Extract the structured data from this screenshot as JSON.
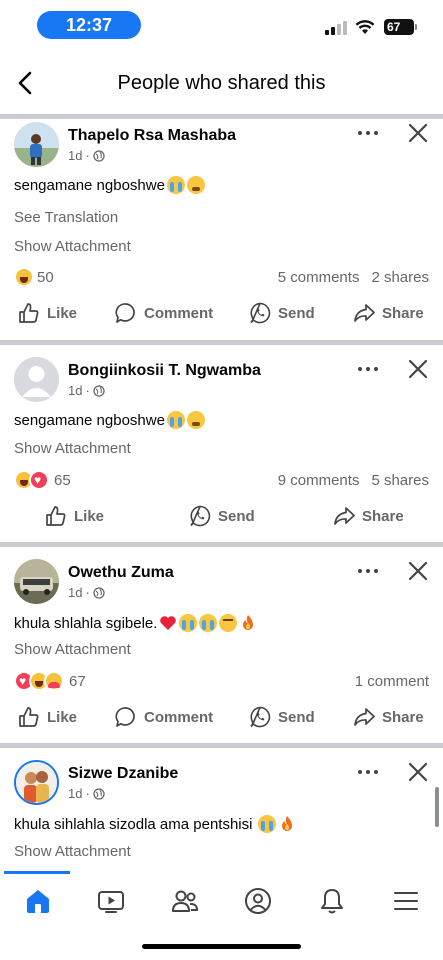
{
  "status_bar": {
    "time": "12:37",
    "battery": "67"
  },
  "header": {
    "title": "People who shared this"
  },
  "posts": [
    {
      "author": "Thapelo Rsa Mashaba",
      "time": "1d",
      "text": "sengamane ngboshwe",
      "emojis": [
        "loudly-crying-face",
        "face-with-steam"
      ],
      "see_translation": "See Translation",
      "show_attachment": "Show Attachment",
      "reaction_icons": [
        "haha"
      ],
      "reaction_count": "50",
      "comments": "5 comments",
      "shares": "2 shares",
      "actions": [
        "Like",
        "Comment",
        "Send",
        "Share"
      ]
    },
    {
      "author": "Bongiinkosii T. Ngwamba",
      "time": "1d",
      "text": "sengamane ngboshwe",
      "emojis": [
        "loudly-crying-face",
        "face-with-steam"
      ],
      "show_attachment": "Show Attachment",
      "reaction_icons": [
        "haha",
        "love"
      ],
      "reaction_count": "65",
      "comments": "9 comments",
      "shares": "5 shares",
      "actions": [
        "Like",
        "Send",
        "Share"
      ]
    },
    {
      "author": "Owethu Zuma",
      "time": "1d",
      "text": "khula shlahla sgibele.",
      "emojis": [
        "red-heart",
        "loudly-crying-face",
        "loudly-crying-face",
        "unamused-face",
        "fire"
      ],
      "show_attachment": "Show Attachment",
      "reaction_icons": [
        "love",
        "haha",
        "care"
      ],
      "reaction_count": "67",
      "comments": "1 comment",
      "actions": [
        "Like",
        "Comment",
        "Send",
        "Share"
      ]
    },
    {
      "author": "Sizwe Dzanibe",
      "time": "1d",
      "text": "khula sihlahla sizodla ama pentshisi",
      "emojis": [
        "loudly-crying-face",
        "fire"
      ],
      "show_attachment": "Show Attachment"
    }
  ],
  "bottom_nav": {
    "items": [
      "home-icon",
      "video-icon",
      "friends-icon",
      "profile-icon",
      "notifications-icon",
      "menu-icon"
    ],
    "active": "home-icon",
    "accent": "#1877f2"
  },
  "colors": {
    "accent": "#1877f2",
    "secondary_text": "#65676b",
    "divider": "#c9ccd1"
  }
}
